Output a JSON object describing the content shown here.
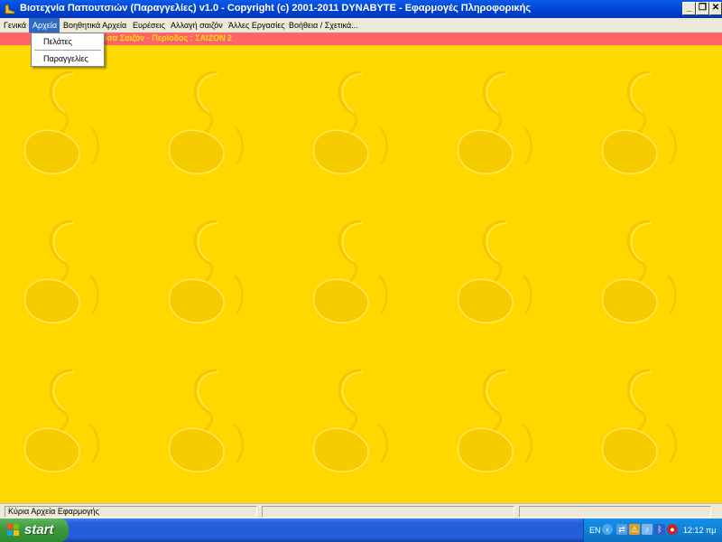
{
  "window": {
    "title": "Βιοτεχνία Παπουτσιών (Παραγγελίες)  v1.0   -   Copyright (c) 2001-2011 DYNABYTE - Εφαρμογές Πληροφορικής",
    "minimize": "_",
    "restore": "❐",
    "close": "✕"
  },
  "menubar": {
    "items": [
      {
        "label": "Γενικά"
      },
      {
        "label": "Αρχεία"
      },
      {
        "label": "Βοηθητικά Αρχεία"
      },
      {
        "label": "Ευρέσεις"
      },
      {
        "label": "Αλλαγή σαιζόν"
      },
      {
        "label": "Άλλες Εργασίες"
      },
      {
        "label": "Βοήθεια / Σχετικά..."
      }
    ],
    "open_menu": {
      "items": [
        {
          "label": "Πελάτες"
        },
        {
          "label": "Παραγγελίες"
        }
      ]
    }
  },
  "info_strip": {
    "text": "ισα Σαιζόν - Περίοδος :  ΣΑΙΖΟΝ 2"
  },
  "statusbar": {
    "panels": [
      {
        "text": "Κύρια Αρχεία Εφαρμογής"
      },
      {
        "text": ""
      },
      {
        "text": ""
      },
      {
        "text": ""
      }
    ]
  },
  "taskbar": {
    "start_label": "start",
    "tray": {
      "language": "EN",
      "clock": "12:12 πμ"
    }
  },
  "colors": {
    "background": "#ffd800",
    "info_strip": "#ff6468",
    "info_text": "#ffe000",
    "menu_highlight": "#316ac5",
    "titlebar": "#0a5ae8",
    "taskbar": "#245edb",
    "start_button": "#3c9b3c"
  },
  "icons": {
    "app": "shoe-icon",
    "tray": [
      "tray-arrow-icon",
      "network-icon",
      "security-icon",
      "volume-icon",
      "bluetooth-icon",
      "antivirus-icon"
    ]
  }
}
